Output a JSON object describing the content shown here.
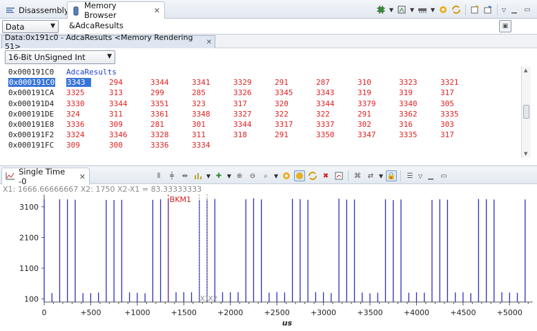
{
  "tabs": {
    "disassembly": "Disassembly",
    "memory_browser": "Memory Browser"
  },
  "address_bar": {
    "space": "Data",
    "expression": "&AdcaResults"
  },
  "rendering_tab": "Data:0x191c0 - AdcaResults <Memory Rendering 51>",
  "format": "16-Bit UnSigned Int",
  "memory": {
    "label_address": "0x000191C0",
    "label": "AdcaResults",
    "rows": [
      {
        "address": "0x000191C0",
        "selected": true,
        "values": [
          "3343",
          "294",
          "3344",
          "3341",
          "3329",
          "291",
          "287",
          "310",
          "3323",
          "3321"
        ]
      },
      {
        "address": "0x000191CA",
        "values": [
          "3325",
          "313",
          "299",
          "285",
          "3326",
          "3345",
          "3343",
          "319",
          "319",
          "317"
        ]
      },
      {
        "address": "0x000191D4",
        "values": [
          "3330",
          "3344",
          "3351",
          "323",
          "317",
          "320",
          "3344",
          "3379",
          "3340",
          "305"
        ]
      },
      {
        "address": "0x000191DE",
        "values": [
          "324",
          "311",
          "3361",
          "3348",
          "3327",
          "322",
          "322",
          "291",
          "3362",
          "3335"
        ]
      },
      {
        "address": "0x000191E8",
        "values": [
          "3336",
          "309",
          "281",
          "301",
          "3344",
          "3317",
          "3337",
          "302",
          "316",
          "303"
        ]
      },
      {
        "address": "0x000191F2",
        "values": [
          "3324",
          "3346",
          "3328",
          "311",
          "318",
          "291",
          "3350",
          "3347",
          "3335",
          "317"
        ]
      },
      {
        "address": "0x000191FC",
        "values": [
          "309",
          "300",
          "3336",
          "3334"
        ]
      }
    ]
  },
  "graph": {
    "tab_title": "Single Time -0",
    "cursor_readout": "X1: 1666.66666667   X2: 1750   X2-X1 = 83.33333333"
  },
  "chart_data": {
    "type": "bar",
    "xlabel": "us",
    "ylabel": "",
    "xlim": [
      0,
      5250
    ],
    "ylim": [
      0,
      3500
    ],
    "yticks": [
      100,
      1100,
      2100,
      3100
    ],
    "xticks": [
      0,
      500,
      1000,
      1500,
      2000,
      2500,
      3000,
      3500,
      4000,
      4500,
      5000
    ],
    "xtick_labels": [
      "0",
      "+500",
      "+1000",
      "+1500",
      "+2000",
      "+2500",
      "+3000",
      "+3500",
      "+4000",
      "+4500",
      "+5000"
    ],
    "bar_color": "#2b2bc0",
    "x_step": 83.3333,
    "values": [
      3343,
      294,
      3344,
      3341,
      3329,
      291,
      287,
      310,
      3323,
      3321,
      3325,
      313,
      299,
      285,
      3326,
      3345,
      3343,
      319,
      319,
      317,
      3330,
      3344,
      3351,
      323,
      317,
      320,
      3344,
      3379,
      3340,
      305,
      324,
      311,
      3361,
      3348,
      3327,
      322,
      322,
      291,
      3362,
      3335,
      3336,
      309,
      281,
      301,
      3344,
      3317,
      3337,
      302,
      316,
      303,
      3324,
      3346,
      3328,
      311,
      318,
      291,
      3350,
      3347,
      3335,
      317,
      309,
      300,
      3336
    ],
    "markers": [
      {
        "label": "BKM1",
        "x": 1333.33,
        "color": "#cc2222"
      },
      {
        "label": "X1",
        "x": 1666.67,
        "color": "#888888"
      },
      {
        "label": "X2",
        "x": 1750,
        "color": "#888888"
      }
    ]
  }
}
